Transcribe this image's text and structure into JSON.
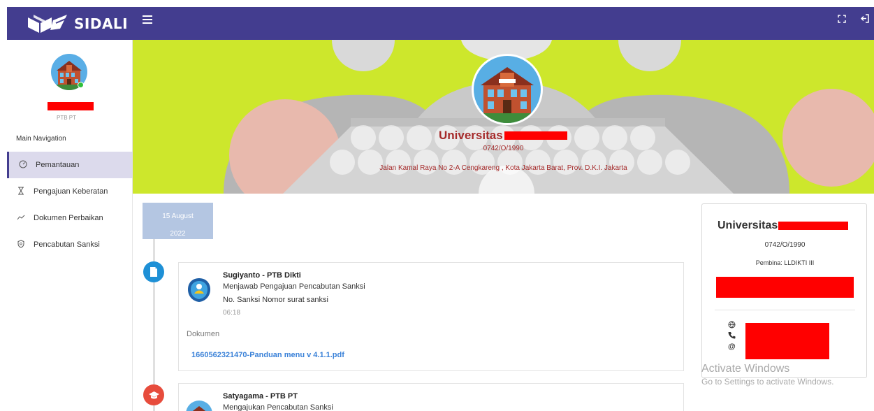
{
  "header": {
    "brand": "SIDALI",
    "menu_icon": "hamburger-icon",
    "fullscreen_icon": "fullscreen-icon",
    "logout_icon": "logout-icon",
    "colors": {
      "topbar": "#433d8f"
    }
  },
  "sidebar": {
    "user_role": "PTB PT",
    "nav_heading": "Main Navigation",
    "items": [
      {
        "label": "Pemantauan",
        "icon": "gauge-icon",
        "active": true
      },
      {
        "label": "Pengajuan Keberatan",
        "icon": "hourglass-icon",
        "active": false
      },
      {
        "label": "Dokumen Perbaikan",
        "icon": "trend-icon",
        "active": false
      },
      {
        "label": "Pencabutan Sanksi",
        "icon": "shield-icon",
        "active": false
      }
    ]
  },
  "banner": {
    "title": "Universitas",
    "code": "0742/O/1990",
    "address": "Jalan Kamal Raya No 2-A Cengkareng , Kota Jakarta Barat, Prov. D.K.I. Jakarta",
    "colors": {
      "background": "#cde72c",
      "title": "#a52a2a"
    }
  },
  "timeline": {
    "date_line1": "15 August",
    "date_line2": "2022",
    "entries": [
      {
        "author": "Sugiyanto - PTB Dikti",
        "action": "Menjawab Pengajuan Pencabutan Sanksi",
        "detail": "No. Sanksi Nomor surat sanksi",
        "time": "06:18",
        "doc_label": "Dokumen",
        "doc_link": "1660562321470-Panduan menu v 4.1.1.pdf",
        "icon": "document-icon",
        "icon_color": "#1e90d6"
      },
      {
        "author": "Satyagama - PTB PT",
        "action": "Mengajukan Pencabutan Sanksi",
        "icon": "graduation-cap-icon",
        "icon_color": "#e74c3c"
      }
    ]
  },
  "profile": {
    "title": "Universitas",
    "code": "0742/O/1990",
    "pembina": "Pembina: LLDIKTI III",
    "contact_icons": [
      "globe-icon",
      "phone-icon",
      "at-icon"
    ]
  },
  "watermark": {
    "line1": "Activate Windows",
    "line2": "Go to Settings to activate Windows."
  }
}
